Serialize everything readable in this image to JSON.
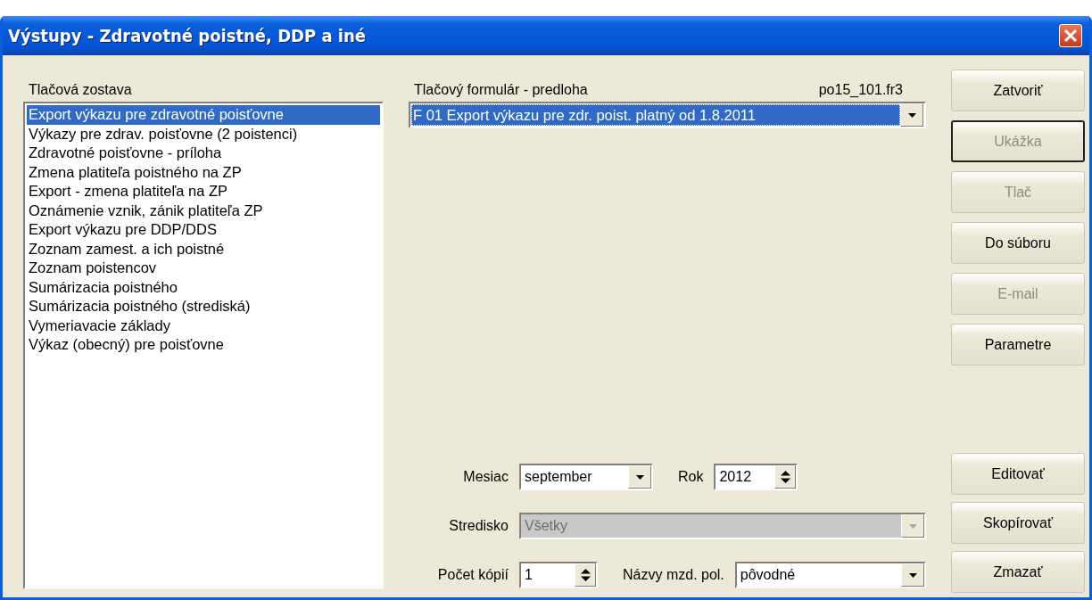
{
  "window": {
    "title": "Výstupy - Zdravotné poistné, DDP a iné"
  },
  "report_list": {
    "label": "Tlačová zostava",
    "items": [
      {
        "label": "Export výkazu pre zdravotné poisťovne",
        "selected": true
      },
      {
        "label": "Výkazy pre zdrav. poisťovne (2 poistenci)",
        "selected": false
      },
      {
        "label": "Zdravotné poisťovne - príloha",
        "selected": false
      },
      {
        "label": "Zmena platiteľa poistného na ZP",
        "selected": false
      },
      {
        "label": "Export - zmena platiteľa na ZP",
        "selected": false
      },
      {
        "label": "Oznámenie vznik, zánik platiteľa ZP",
        "selected": false
      },
      {
        "label": "Export výkazu pre DDP/DDS",
        "selected": false
      },
      {
        "label": "Zoznam zamest. a ich poistné",
        "selected": false
      },
      {
        "label": "Zoznam poistencov",
        "selected": false
      },
      {
        "label": "Sumárizacia poistného",
        "selected": false
      },
      {
        "label": "Sumárizacia poistného (strediská)",
        "selected": false
      },
      {
        "label": "Vymeriavacie základy",
        "selected": false
      },
      {
        "label": "Výkaz (obecný) pre poisťovne",
        "selected": false
      }
    ]
  },
  "form": {
    "label": "Tlačový formulár - predloha",
    "file": "po15_101.fr3",
    "value": "F 01 Export výkazu pre zdr. poist. platný od 1.8.2011",
    "focused": true
  },
  "field_rows": [
    {
      "fields": [
        {
          "kind": "dropdown",
          "label": "Mesiac",
          "value": "september",
          "disabled": false
        },
        {
          "kind": "spinner",
          "label": "Rok",
          "value": "2012",
          "disabled": false
        }
      ]
    },
    {
      "fields": [
        {
          "kind": "dropdown",
          "label": "Stredisko",
          "value": "Všetky",
          "disabled": true
        }
      ]
    },
    {
      "fields": [
        {
          "kind": "spinner",
          "label": "Počet kópií",
          "value": "1",
          "disabled": false
        },
        {
          "kind": "dropdown",
          "label": "Názvy mzd. pol.",
          "value": "pôvodné",
          "disabled": false
        }
      ]
    }
  ],
  "buttons_top": [
    {
      "label": "Zatvoriť",
      "disabled": false,
      "focused": false
    },
    {
      "label": "Ukážka",
      "disabled": true,
      "focused": true
    },
    {
      "label": "Tlač",
      "disabled": true,
      "focused": false
    },
    {
      "label": "Do súboru",
      "disabled": false,
      "focused": false
    },
    {
      "label": "E-mail",
      "disabled": true,
      "focused": false
    },
    {
      "label": "Parametre",
      "disabled": false,
      "focused": false
    }
  ],
  "buttons_bottom": [
    {
      "label": "Editovať",
      "disabled": false,
      "focused": false
    },
    {
      "label": "Skopírovať",
      "disabled": false,
      "focused": false
    },
    {
      "label": "Zmazať",
      "disabled": false,
      "focused": false
    }
  ]
}
